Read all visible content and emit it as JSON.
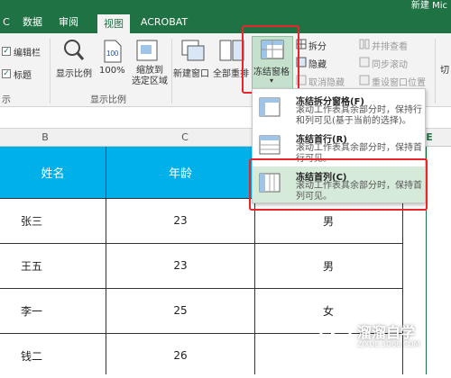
{
  "titlebar": {
    "title": "新建 Mic"
  },
  "tabs": [
    "C",
    "数据",
    "审阅",
    "视图",
    "ACROBAT"
  ],
  "ribbon": {
    "show_group": {
      "items": [
        "编辑栏",
        "标题"
      ],
      "label": "示"
    },
    "zoom_group": {
      "label": "显示比例",
      "buttons": [
        "显示比例",
        "100%",
        "缩放到\n选定区域"
      ]
    },
    "window_group": {
      "new_window": "新建窗口",
      "arrange_all": "全部重排",
      "freeze_panes": "冻结窗格",
      "split": "拆分",
      "hide": "隐藏",
      "unhide": "取消隐藏",
      "view_side_by_side": "并排查看",
      "sync_scroll": "同步滚动",
      "reset_position": "重设窗口位置",
      "switch": "切"
    }
  },
  "columns": [
    "B",
    "C",
    "E"
  ],
  "table": {
    "headers": [
      "姓名",
      "年龄"
    ],
    "rows": [
      {
        "name": "张三",
        "age": "23",
        "extra": "男"
      },
      {
        "name": "王五",
        "age": "23",
        "extra": "男"
      },
      {
        "name": "李一",
        "age": "25",
        "extra": "女"
      },
      {
        "name": "钱二",
        "age": "26",
        "extra": ""
      }
    ]
  },
  "dropdown": {
    "items": [
      {
        "title": "冻结拆分窗格(F)",
        "desc": "滚动工作表其余部分时，保持行和列可见(基于当前的选择)。"
      },
      {
        "title": "冻结首行(R)",
        "desc": "滚动工作表其余部分时，保持首行可见。"
      },
      {
        "title": "冻结首列(C)",
        "desc": "滚动工作表其余部分时，保持首列可见。"
      }
    ]
  },
  "watermark": {
    "brand": "溜溜自学",
    "url": "ZIXUE.3D66.COM"
  },
  "colors": {
    "accent": "#1f7244",
    "header_fill": "#00b0e8",
    "highlight": "#e8252b"
  }
}
